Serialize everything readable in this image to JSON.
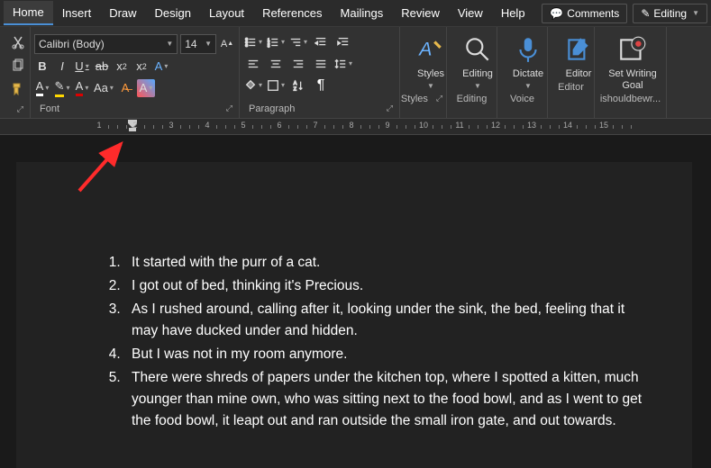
{
  "menu": {
    "tabs": [
      "Home",
      "Insert",
      "Draw",
      "Design",
      "Layout",
      "References",
      "Mailings",
      "Review",
      "View",
      "Help"
    ],
    "active": 0,
    "comments": "Comments",
    "editing": "Editing"
  },
  "ribbon": {
    "font": {
      "name": "Calibri (Body)",
      "size": "14",
      "group_label": "Font"
    },
    "paragraph": {
      "group_label": "Paragraph"
    },
    "styles": {
      "label": "Styles",
      "group_label": "Styles"
    },
    "editing": {
      "label": "Editing",
      "group_label": "Editing"
    },
    "voice": {
      "label": "Dictate",
      "group_label": "Voice"
    },
    "editor": {
      "label": "Editor",
      "group_label": "Editor"
    },
    "goal": {
      "label1": "Set Writing",
      "label2": "Goal",
      "group_label": "ishouldbewr..."
    }
  },
  "ruler": {
    "marks": [
      "1",
      "2",
      "3",
      "4",
      "5",
      "6",
      "7",
      "8",
      "9",
      "10",
      "11",
      "12",
      "13",
      "14",
      "15"
    ]
  },
  "document": {
    "items": [
      "It started with the purr of a cat.",
      "I got out of bed, thinking it's Precious.",
      "As I rushed around, calling after it, looking under the sink, the bed, feeling that it may have ducked under and hidden.",
      "But I was not in my room anymore.",
      "There were shreds of papers under the kitchen top, where I spotted a kitten, much younger than mine own, who was sitting next to the food bowl, and as I went to get the food bowl, it leapt out and ran outside the small iron gate, and out towards."
    ]
  }
}
